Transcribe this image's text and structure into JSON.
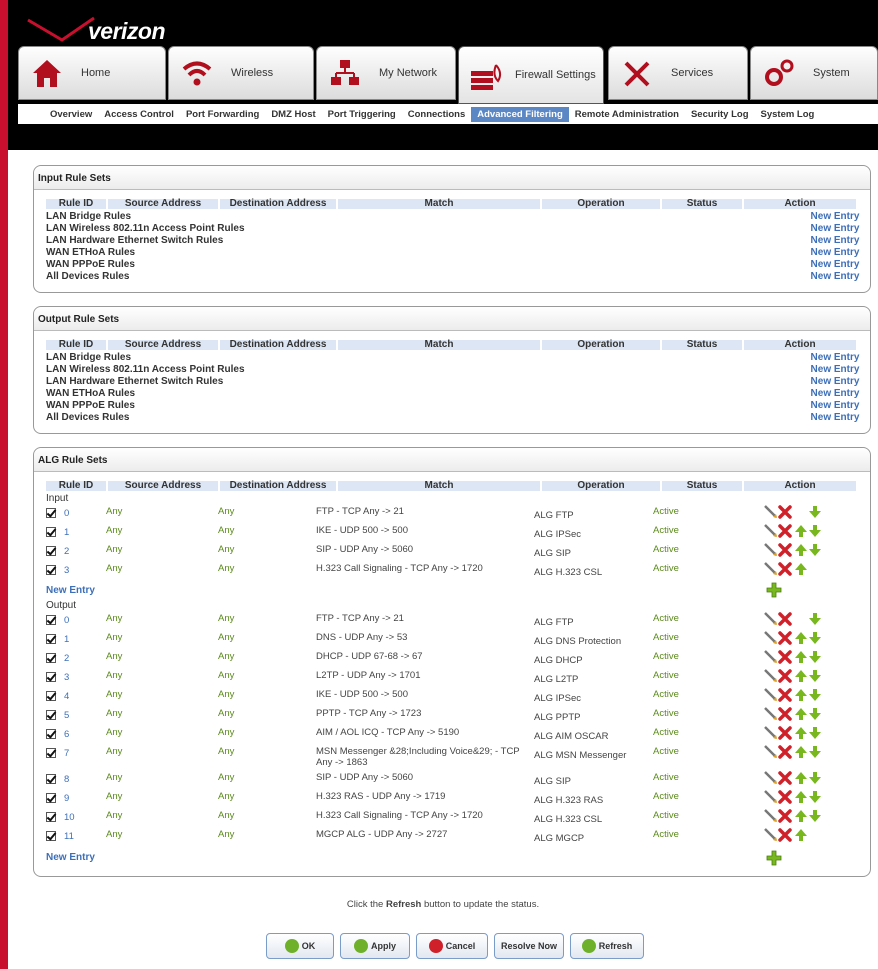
{
  "brand": {
    "logo": "verizon"
  },
  "tabs": [
    {
      "label": "Home",
      "icon": "home-icon"
    },
    {
      "label": "Wireless",
      "icon": "wireless-icon"
    },
    {
      "label": "My Network",
      "icon": "network-icon"
    },
    {
      "label": "Firewall Settings",
      "icon": "firewall-icon",
      "active": true
    },
    {
      "label": "Services",
      "icon": "tools-icon"
    },
    {
      "label": "System",
      "icon": "gears-icon"
    }
  ],
  "subnav": [
    "Overview",
    "Access Control",
    "Port Forwarding",
    "DMZ Host",
    "Port Triggering",
    "Connections",
    "Advanced Filtering",
    "Remote Administration",
    "Security Log",
    "System Log"
  ],
  "subnav_active": "Advanced Filtering",
  "columns": [
    "Rule ID",
    "Source Address",
    "Destination Address",
    "Match",
    "Operation",
    "Status",
    "Action"
  ],
  "input_sets": {
    "title": "Input Rule Sets",
    "rows": [
      "LAN Bridge Rules",
      "LAN Wireless 802.11n Access Point Rules",
      "LAN Hardware Ethernet Switch Rules",
      "WAN ETHoA Rules",
      "WAN PPPoE Rules",
      "All Devices Rules"
    ],
    "action": "New Entry"
  },
  "output_sets": {
    "title": "Output Rule Sets",
    "rows": [
      "LAN Bridge Rules",
      "LAN Wireless 802.11n Access Point Rules",
      "LAN Hardware Ethernet Switch Rules",
      "WAN ETHoA Rules",
      "WAN PPPoE Rules",
      "All Devices Rules"
    ],
    "action": "New Entry"
  },
  "alg": {
    "title": "ALG Rule Sets",
    "input_label": "Input",
    "output_label": "Output",
    "new_entry": "New Entry",
    "input": [
      {
        "id": "0",
        "src": "Any",
        "dst": "Any",
        "match": "FTP - TCP Any -> 21",
        "op": "ALG FTP",
        "status": "Active",
        "up": false,
        "down": true
      },
      {
        "id": "1",
        "src": "Any",
        "dst": "Any",
        "match": "IKE - UDP 500 -> 500",
        "op": "ALG IPSec",
        "status": "Active",
        "up": true,
        "down": true
      },
      {
        "id": "2",
        "src": "Any",
        "dst": "Any",
        "match": "SIP - UDP Any -> 5060",
        "op": "ALG SIP",
        "status": "Active",
        "up": true,
        "down": true
      },
      {
        "id": "3",
        "src": "Any",
        "dst": "Any",
        "match": "H.323 Call Signaling - TCP Any -> 1720",
        "op": "ALG H.323 CSL",
        "status": "Active",
        "up": true,
        "down": false
      }
    ],
    "output": [
      {
        "id": "0",
        "src": "Any",
        "dst": "Any",
        "match": "FTP - TCP Any -> 21",
        "op": "ALG FTP",
        "status": "Active",
        "up": false,
        "down": true
      },
      {
        "id": "1",
        "src": "Any",
        "dst": "Any",
        "match": "DNS - UDP Any -> 53",
        "op": "ALG DNS Protection",
        "status": "Active",
        "up": true,
        "down": true
      },
      {
        "id": "2",
        "src": "Any",
        "dst": "Any",
        "match": "DHCP - UDP 67-68 -> 67",
        "op": "ALG DHCP",
        "status": "Active",
        "up": true,
        "down": true
      },
      {
        "id": "3",
        "src": "Any",
        "dst": "Any",
        "match": "L2TP - UDP Any -> 1701",
        "op": "ALG L2TP",
        "status": "Active",
        "up": true,
        "down": true
      },
      {
        "id": "4",
        "src": "Any",
        "dst": "Any",
        "match": "IKE - UDP 500 -> 500",
        "op": "ALG IPSec",
        "status": "Active",
        "up": true,
        "down": true
      },
      {
        "id": "5",
        "src": "Any",
        "dst": "Any",
        "match": "PPTP - TCP Any -> 1723",
        "op": "ALG PPTP",
        "status": "Active",
        "up": true,
        "down": true
      },
      {
        "id": "6",
        "src": "Any",
        "dst": "Any",
        "match": "AIM / AOL ICQ - TCP Any -> 5190",
        "op": "ALG AIM OSCAR",
        "status": "Active",
        "up": true,
        "down": true
      },
      {
        "id": "7",
        "src": "Any",
        "dst": "Any",
        "match": "MSN Messenger &28;Including Voice&29; - TCP Any -> 1863",
        "op": "ALG MSN Messenger",
        "status": "Active",
        "up": true,
        "down": true
      },
      {
        "id": "8",
        "src": "Any",
        "dst": "Any",
        "match": "SIP - UDP Any -> 5060",
        "op": "ALG SIP",
        "status": "Active",
        "up": true,
        "down": true
      },
      {
        "id": "9",
        "src": "Any",
        "dst": "Any",
        "match": "H.323 RAS - UDP Any -> 1719",
        "op": "ALG H.323 RAS",
        "status": "Active",
        "up": true,
        "down": true
      },
      {
        "id": "10",
        "src": "Any",
        "dst": "Any",
        "match": "H.323 Call Signaling - TCP Any -> 1720",
        "op": "ALG H.323 CSL",
        "status": "Active",
        "up": true,
        "down": true
      },
      {
        "id": "11",
        "src": "Any",
        "dst": "Any",
        "match": "MGCP ALG - UDP Any -> 2727",
        "op": "ALG MGCP",
        "status": "Active",
        "up": true,
        "down": false
      }
    ]
  },
  "footer": {
    "note_pre": "Click the ",
    "note_bold": "Refresh",
    "note_post": " button to update the status.",
    "buttons": [
      "OK",
      "Apply",
      "Cancel",
      "Resolve Now",
      "Refresh"
    ]
  },
  "colors": {
    "brand_red": "#c8102e",
    "link_blue": "#3d6fb8",
    "active_green": "#5b8a1a",
    "selected_tab": "#5b87c5"
  }
}
